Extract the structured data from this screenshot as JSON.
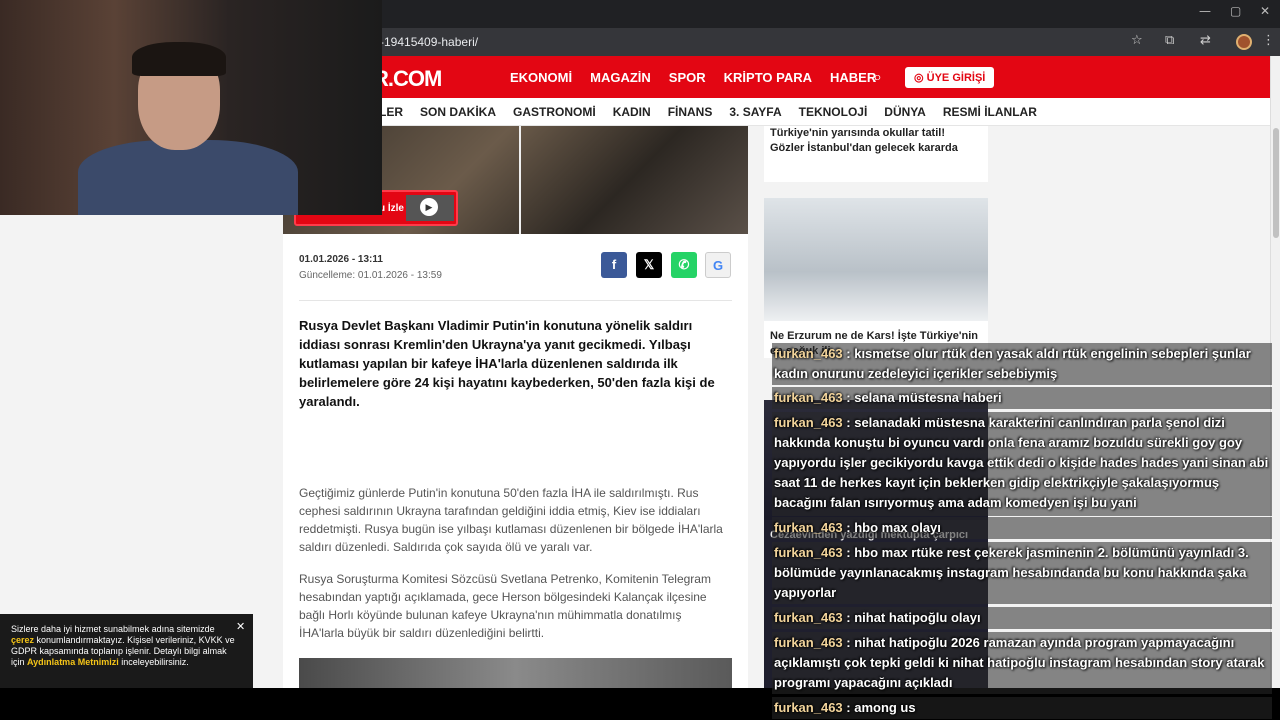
{
  "browser": {
    "url": "-19415409-haberi/",
    "window_controls": [
      "—",
      "▢",
      "✕"
    ]
  },
  "site": {
    "logo": "R.COM",
    "topnav": [
      "EKONOMİ",
      "MAGAZİN",
      "SPOR",
      "KRİPTO PARA",
      "HABER"
    ],
    "login_label": "ÜYE GİRİŞİ",
    "subnav": [
      "RİLER",
      "SON DAKİKA",
      "GASTRONOMİ",
      "KADIN",
      "FİNANS",
      "3. SAYFA",
      "TEKNOLOJİ",
      "DÜNYA",
      "RESMİ İLANLAR"
    ],
    "accent": "#e30613"
  },
  "hero": {
    "video_button_label": "Haber Videosunu İzle"
  },
  "article": {
    "date": "01.01.2026 - 13:11",
    "updated": "Güncelleme: 01.01.2026 - 13:59",
    "share": {
      "facebook": "f",
      "x": "𝕏",
      "whatsapp": "✆",
      "google": "G"
    },
    "lead": "Rusya Devlet Başkanı Vladimir Putin'in konutuna yönelik saldırı iddiası sonrası Kremlin'den Ukrayna'ya yanıt gecikmedi. Yılbaşı kutlaması yapılan bir kafeye İHA'larla düzenlenen saldırıda ilk belirlemelere göre 24 kişi hayatını kaybederken, 50'den fazla kişi de yaralandı.",
    "paragraph1": "Geçtiğimiz günlerde Putin'in konutuna 50'den fazla İHA ile saldırılmıştı. Rus cephesi saldırının Ukrayna tarafından geldiğini iddia etmiş, Kiev ise iddiaları reddetmişti. Rusya bugün ise yılbaşı kutlaması düzenlenen bir bölgede İHA'larla saldırı düzenledi. Saldırıda çok sayıda ölü ve yaralı var.",
    "paragraph2": "Rusya Soruşturma Komitesi Sözcüsü Svetlana Petrenko, Komitenin Telegram hesabından yaptığı açıklamada, gece Herson bölgesindeki Kalançak ilçesine bağlı Horlı köyünde bulunan kafeye Ukrayna'nın mühimmatla donatılmış İHA'larla büyük bir saldırı düzenlediğini belirtti."
  },
  "sidebar": {
    "card1_title": "Türkiye'nin yarısında okullar tatil! Gözler İstanbul'dan gelecek kararda",
    "card2_title": "Ne Erzurum ne de Kars! İşte Türkiye'nin en soğuk ili",
    "card3_title": "Cezaevinden yazdığı mektupta çarpıcı"
  },
  "cookie": {
    "text_before": "Sizlere daha iyi hizmet sunabilmek adına sitemizde ",
    "highlight1": "çerez",
    "text_middle": " konumlandırmaktayız. Kişisel verileriniz, KVKK ve GDPR kapsamında toplanıp işlenir. Detaylı bilgi almak için ",
    "highlight2": "Aydınlatma Metnimizi",
    "text_after": " inceleyebilirsiniz.",
    "close": "✕"
  },
  "chat": [
    {
      "user": "furkan_463",
      "text": " : kısmetse olur rtük den yasak aldı rtük engelinin sebepleri şunlar kadın onurunu zedeleyici içerikler sebebiymiş"
    },
    {
      "user": "furkan_463",
      "text": " : selana müstesna haberi"
    },
    {
      "user": "furkan_463",
      "text": " : selanadaki müstesna karakterini canlındıran parla şenol dizi hakkında konuştu bi oyuncu vardı onla fena aramız bozuldu sürekli goy goy yapıyordu işler gecikiyordu kavga ettik dedi o kişide hades hades yani sinan abi saat 11 de herkes kayıt için beklerken gidip elektrikçiyle şakalaşıyormuş bacağını falan ısırıyormuş ama adam komedyen işi bu yani"
    },
    {
      "user": "furkan_463",
      "text": " : hbo max olayı"
    },
    {
      "user": "furkan_463",
      "text": " : hbo max rtüke rest çekerek jasminenin 2. bölümünü yayınladı 3. bölümüde yayınlanacakmış instagram hesabındanda bu konu hakkında şaka yapıyorlar"
    },
    {
      "user": "furkan_463",
      "text": " : nihat hatipoğlu olayı"
    },
    {
      "user": "furkan_463",
      "text": " : nihat hatipoğlu 2026 ramazan ayında program yapmayacağını açıklamıştı çok tepki geldi ki nihat hatipoğlu instagram hesabından story atarak programı yapacağını açıkladı"
    },
    {
      "user": "furkan_463",
      "text": " : among us"
    }
  ]
}
